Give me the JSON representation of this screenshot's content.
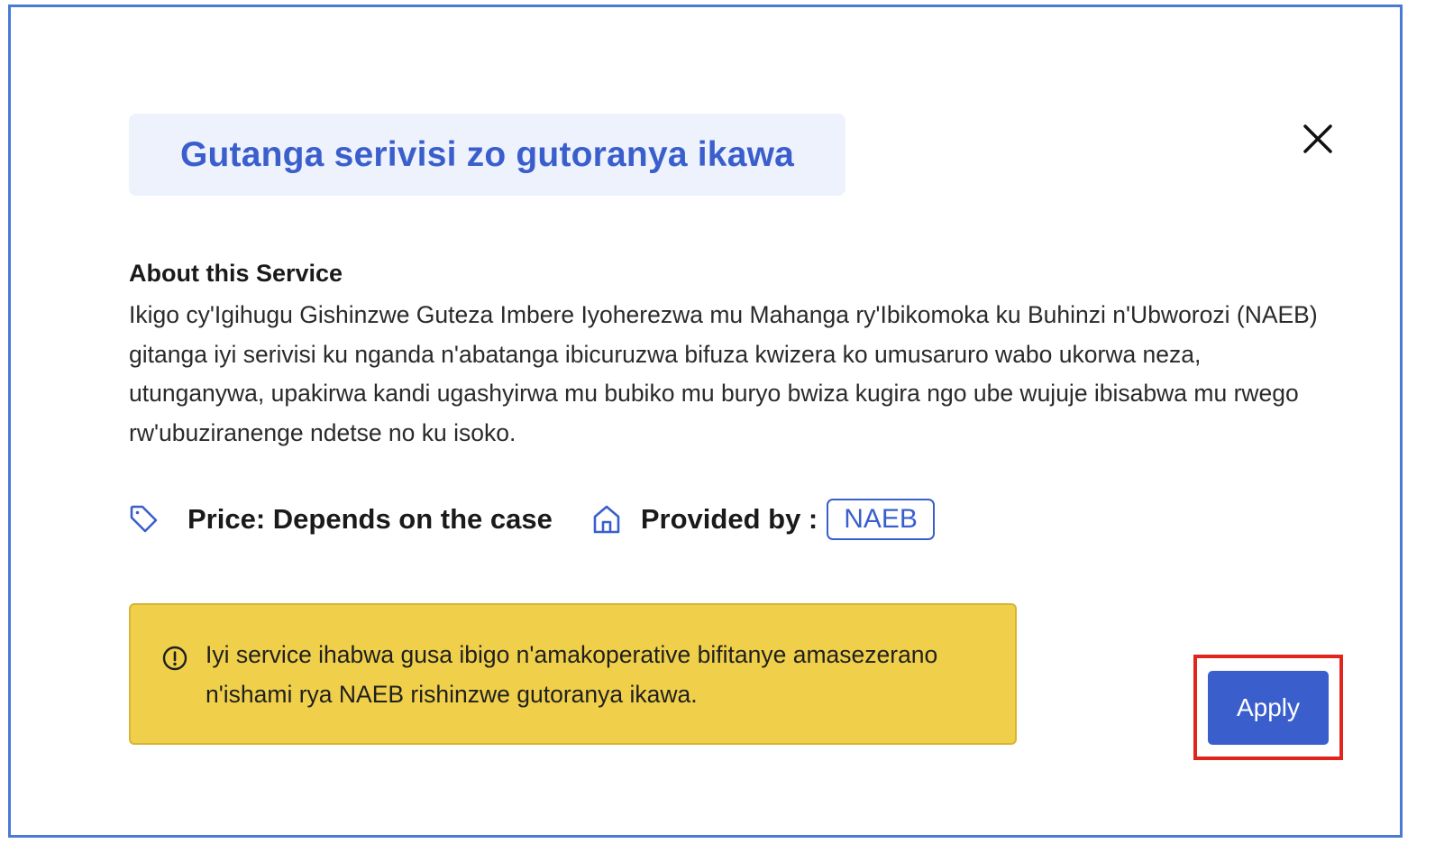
{
  "dialog": {
    "title": "Gutanga serivisi zo gutoranya ikawa",
    "close_icon": "close-icon"
  },
  "about": {
    "heading": "About this Service",
    "body": "Ikigo cy'Igihugu Gishinzwe Guteza Imbere Iyoherezwa mu Mahanga ry'Ibikomoka ku Buhinzi n'Ubworozi (NAEB) gitanga iyi serivisi ku nganda n'abatanga ibicuruzwa bifuza kwizera ko umusaruro wabo ukorwa neza, utunganywa, upakirwa kandi ugashyirwa mu bubiko mu buryo bwiza kugira ngo ube wujuje ibisabwa mu rwego rw'ubuziranenge ndetse no ku isoko."
  },
  "meta": {
    "price_icon": "tag-icon",
    "price_text": "Price: Depends on the case",
    "provider_icon": "home-icon",
    "provided_by_label": "Provided by :",
    "provider_name": "NAEB"
  },
  "notice": {
    "icon": "info-icon",
    "text": "Iyi service ihabwa gusa ibigo n'amakoperative bifitanye amasezerano n'ishami rya NAEB rishinzwe gutoranya ikawa."
  },
  "actions": {
    "apply_label": "Apply"
  },
  "colors": {
    "frame_border": "#4a7bd4",
    "accent": "#3a5fcd",
    "title_bg": "#eef2fc",
    "notice_bg": "#f0d04a",
    "highlight": "#e1251b"
  }
}
